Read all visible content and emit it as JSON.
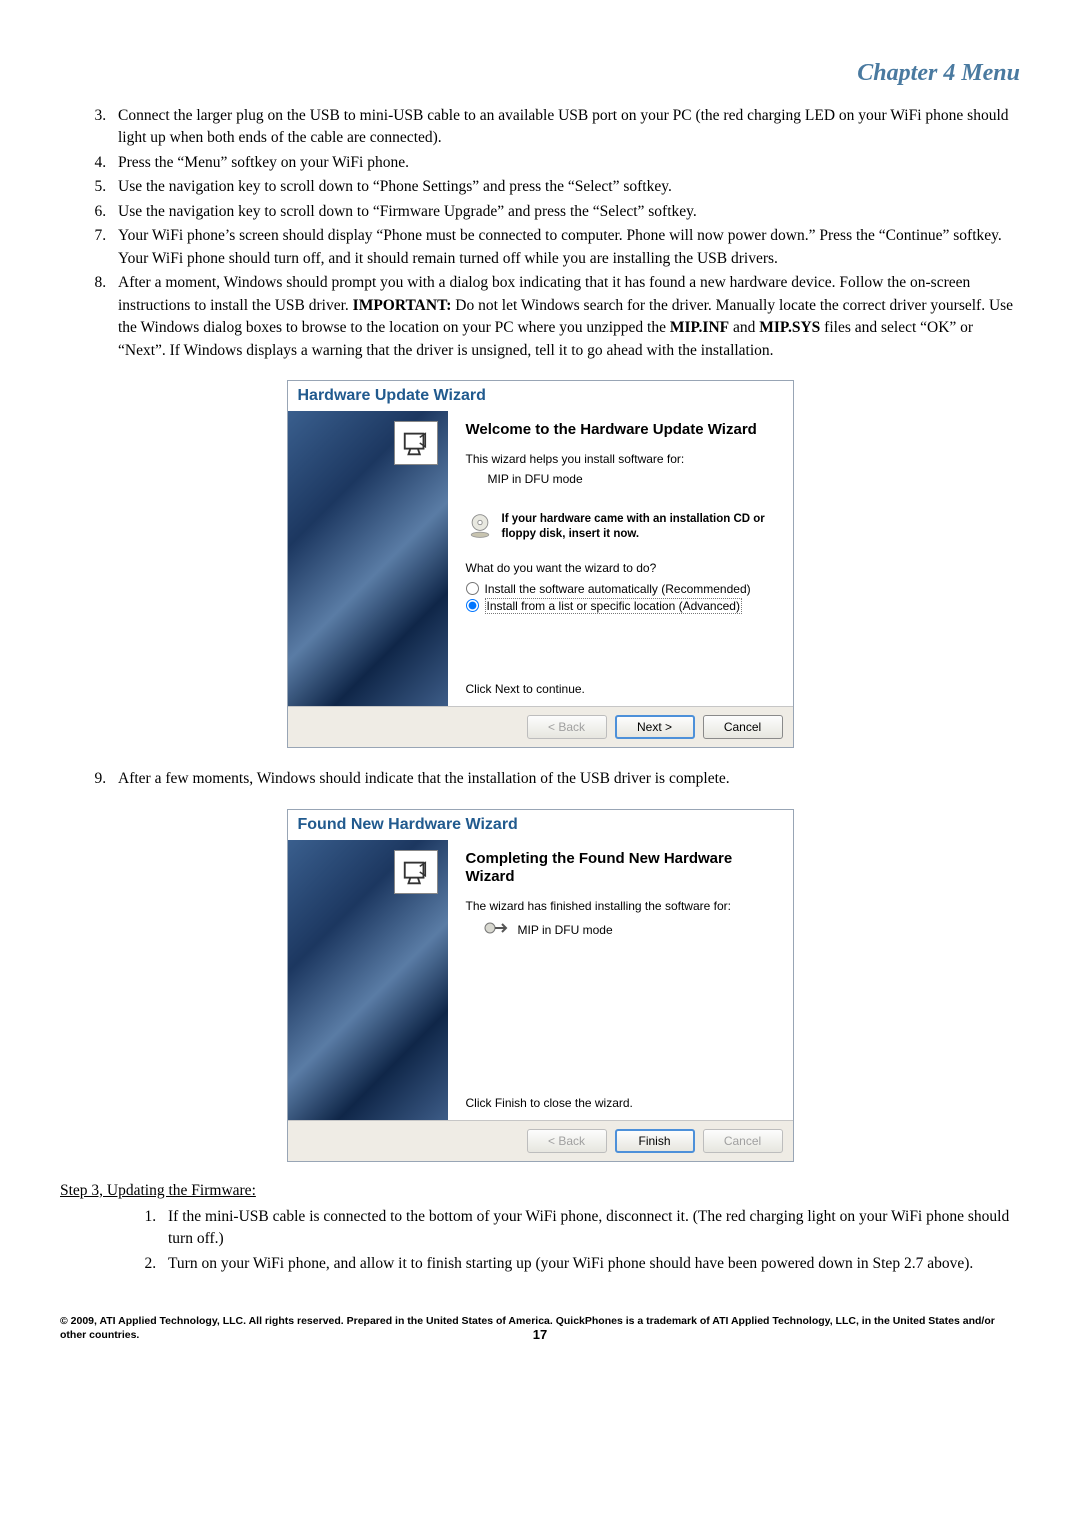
{
  "chapter_title": "Chapter 4 Menu",
  "list_first": {
    "start": 3,
    "items": [
      "Connect the larger plug on the USB to mini-USB cable to an available USB port on your PC (the red charging LED on your WiFi phone should light up when both ends of the cable are connected).",
      "Press the “Menu” softkey on your WiFi phone.",
      "Use the navigation key to scroll down to “Phone Settings” and press the “Select” softkey.",
      "Use the navigation key to scroll down to “Firmware Upgrade” and press the “Select” softkey.",
      "Your WiFi phone’s screen should display “Phone must be connected to computer. Phone will now power down.” Press the “Continue” softkey. Your WiFi phone should turn off, and it should remain turned off while you are installing the USB drivers."
    ],
    "item8": {
      "pre": "After a moment, Windows should prompt you with a dialog box indicating that it has found a new hardware device. Follow the on-screen instructions to install the USB driver. ",
      "important_label": "IMPORTANT:",
      "mid1": " Do not let Windows search for the driver. Manually locate the correct driver yourself. Use the Windows dialog boxes to browse to the location on your PC where you unzipped the ",
      "file1": "MIP.INF",
      "and": " and ",
      "file2": "MIP.SYS",
      "post": " files and select “OK” or “Next”. If Windows displays a warning that the driver is unsigned, tell it to go ahead with the installation."
    },
    "item9": "After a few moments, Windows should indicate that the installation of the USB driver is complete."
  },
  "wizard1": {
    "title": "Hardware Update Wizard",
    "heading": "Welcome to the Hardware Update Wizard",
    "helps": "This wizard helps you install software for:",
    "device": "MIP in DFU mode",
    "cd_text": "If your hardware came with an installation CD or floppy disk, insert it now.",
    "what_do": "What do you want the wizard to do?",
    "opt_auto": "Install the software automatically (Recommended)",
    "opt_list": "Install from a list or specific location (Advanced)",
    "click_next": "Click Next to continue.",
    "back": "< Back",
    "next": "Next >",
    "cancel": "Cancel"
  },
  "wizard2": {
    "title": "Found New Hardware Wizard",
    "heading": "Completing the Found New Hardware Wizard",
    "finished": "The wizard has finished installing the software for:",
    "device": "MIP in DFU mode",
    "click_finish": "Click Finish to close the wizard.",
    "back": "< Back",
    "finish": "Finish",
    "cancel": "Cancel"
  },
  "step3_heading": "Step 3, Updating the Firmware:",
  "list_step3": {
    "start": 1,
    "items": [
      "If the mini-USB cable is connected to the bottom of your WiFi phone, disconnect it. (The red charging light on your WiFi phone should turn off.)",
      "Turn on your WiFi phone, and allow it to finish starting up (your WiFi phone should have been powered down in Step 2.7 above)."
    ]
  },
  "footer": {
    "text": "© 2009, ATI Applied Technology, LLC. All rights reserved. Prepared in the United States of America. QuickPhones is a trademark of ATI Applied Technology, LLC, in the United States and/or other countries.",
    "page": "17"
  }
}
